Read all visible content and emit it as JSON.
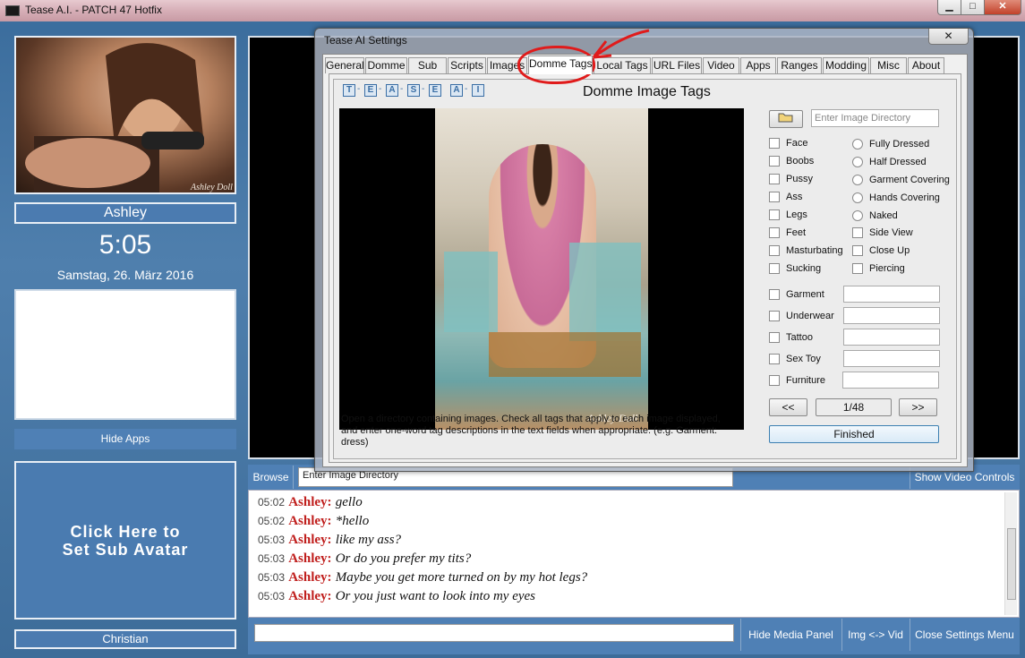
{
  "app": {
    "title": "Tease A.I. - PATCH 47 Hotfix"
  },
  "window_controls": {
    "minimize": "▁",
    "maximize": "□",
    "close": "✕"
  },
  "left": {
    "domme_name": "Ashley",
    "clock": "5:05",
    "date": "Samstag, 26. März 2016",
    "hide_apps": "Hide Apps",
    "sub_avatar_text": "Click Here to\nSet Sub Avatar",
    "sub_name": "Christian"
  },
  "toolbar": {
    "browse": "Browse",
    "dir_value": "Enter Image Directory",
    "show_video_controls": "Show Video Controls"
  },
  "chat": [
    {
      "time": "05:02",
      "name": "Ashley:",
      "msg": "gello"
    },
    {
      "time": "05:02",
      "name": "Ashley:",
      "msg": "*hello"
    },
    {
      "time": "05:03",
      "name": "Ashley:",
      "msg": "like my ass?"
    },
    {
      "time": "05:03",
      "name": "Ashley:",
      "msg": "Or do you prefer my tits?"
    },
    {
      "time": "05:03",
      "name": "Ashley:",
      "msg": "Maybe you get more turned on by my hot legs?"
    },
    {
      "time": "05:03",
      "name": "Ashley:",
      "msg": "Or you just want to look into my eyes"
    }
  ],
  "bottom": {
    "hide_media_panel": "Hide Media Panel",
    "img_vid": "Img <-> Vid",
    "close_settings_menu": "Close Settings Menu"
  },
  "settings": {
    "title": "Tease AI Settings",
    "close": "✕",
    "tabs": [
      "General",
      "Domme",
      "Sub",
      "Scripts",
      "Images",
      "Domme Tags",
      "Local Tags",
      "URL Files",
      "Video",
      "Apps",
      "Ranges",
      "Modding",
      "Misc",
      "About"
    ],
    "active_tab": "Domme Tags",
    "logo_letters": [
      "T",
      "E",
      "A",
      "S",
      "E",
      "A",
      "I"
    ],
    "panel_title": "Domme Image Tags",
    "image_dir_placeholder": "Enter Image Directory",
    "checkboxes_left": [
      "Face",
      "Boobs",
      "Pussy",
      "Ass",
      "Legs",
      "Feet",
      "Masturbating",
      "Sucking"
    ],
    "radios_right": [
      "Fully Dressed",
      "Half Dressed",
      "Garment Covering",
      "Hands Covering",
      "Naked"
    ],
    "checkboxes_right": [
      "Side View",
      "Close Up",
      "Piercing"
    ],
    "text_tags": [
      "Garment",
      "Underwear",
      "Tattoo",
      "Sex Toy",
      "Furniture"
    ],
    "prev": "<<",
    "counter": "1/48",
    "next": ">>",
    "finished": "Finished",
    "instructions": "Open a directory containing images. Check all tags that apply to each image displayed, and enter one-word tag descriptions in the text fields when appropriate. (e.g. Garment: dress)",
    "photo_watermark": "Ashley Doll"
  },
  "colors": {
    "accent": "#4f80b5",
    "annotation": "#e01b1b",
    "chat_name": "#c0201e"
  }
}
